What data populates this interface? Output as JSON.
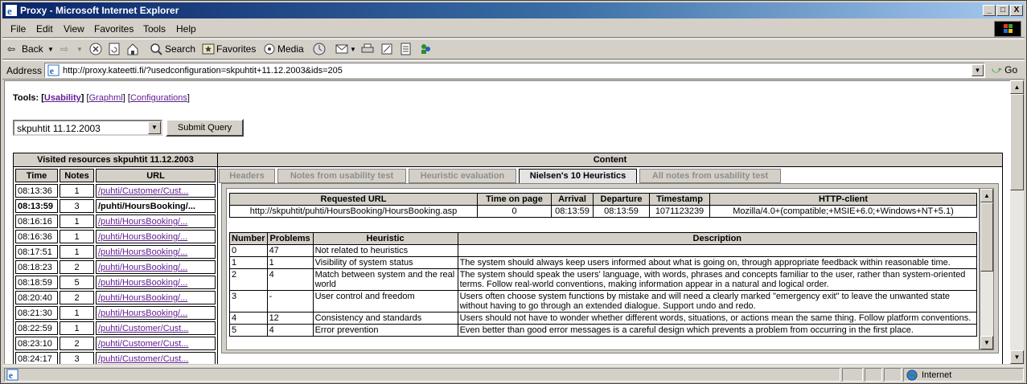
{
  "window": {
    "title": "Proxy - Microsoft Internet Explorer",
    "min": "_",
    "max": "□",
    "close": "X"
  },
  "menu": [
    "File",
    "Edit",
    "View",
    "Favorites",
    "Tools",
    "Help"
  ],
  "toolbar": {
    "back": "Back",
    "search": "Search",
    "favorites": "Favorites",
    "media": "Media"
  },
  "address": {
    "label": "Address",
    "url": "http://proxy.kateetti.fi/?usedconfiguration=skpuhtit+11.12.2003&ids=205",
    "go": "Go"
  },
  "tools": {
    "label": "Tools:",
    "links": [
      "Usability",
      "Graphml",
      "Configurations"
    ]
  },
  "config": {
    "selected": "skpuhtit 11.12.2003",
    "submit": "Submit Query"
  },
  "visited": {
    "title": "Visited resources skpuhtit 11.12.2003",
    "columns": [
      "Time",
      "Notes",
      "URL"
    ],
    "rows": [
      {
        "time": "08:13:36",
        "notes": "1",
        "url": "/puhti/Customer/Cust..."
      },
      {
        "time": "08:13:59",
        "notes": "3",
        "url": "/puhti/HoursBooking/..."
      },
      {
        "time": "08:16:16",
        "notes": "1",
        "url": "/puhti/HoursBooking/..."
      },
      {
        "time": "08:16:36",
        "notes": "1",
        "url": "/puhti/HoursBooking/..."
      },
      {
        "time": "08:17:51",
        "notes": "1",
        "url": "/puhti/HoursBooking/..."
      },
      {
        "time": "08:18:23",
        "notes": "2",
        "url": "/puhti/HoursBooking/..."
      },
      {
        "time": "08:18:59",
        "notes": "5",
        "url": "/puhti/HoursBooking/..."
      },
      {
        "time": "08:20:40",
        "notes": "2",
        "url": "/puhti/HoursBooking/..."
      },
      {
        "time": "08:21:30",
        "notes": "1",
        "url": "/puhti/HoursBooking/..."
      },
      {
        "time": "08:22:59",
        "notes": "1",
        "url": "/puhti/Customer/Cust..."
      },
      {
        "time": "08:23:10",
        "notes": "2",
        "url": "/puhti/Customer/Cust..."
      },
      {
        "time": "08:24:17",
        "notes": "3",
        "url": "/puhti/Customer/Cust..."
      }
    ]
  },
  "content": {
    "title": "Content",
    "tabs": [
      "Headers",
      "Notes from usability test",
      "Heuristic evaluation",
      "Nielsen's 10 Heuristics",
      "All notes from usability test"
    ],
    "request": {
      "columns": [
        "Requested URL",
        "Time on page",
        "Arrival",
        "Departure",
        "Timestamp",
        "HTTP-client"
      ],
      "row": [
        "http://skpuhtit/puhti/HoursBooking/HoursBooking.asp",
        "0",
        "08:13:59",
        "08:13:59",
        "1071123239",
        "Mozilla/4.0+(compatible;+MSIE+6.0;+Windows+NT+5.1)"
      ]
    },
    "heuristics": {
      "columns": [
        "Number",
        "Problems",
        "Heuristic",
        "Description"
      ],
      "rows": [
        {
          "n": "0",
          "p": "47",
          "h": "Not related to heuristics",
          "d": ""
        },
        {
          "n": "1",
          "p": "1",
          "h": "Visibility of system status",
          "d": "The system should always keep users informed about what is going on, through appropriate feedback within reasonable time."
        },
        {
          "n": "2",
          "p": "4",
          "h": "Match between system and the real world",
          "d": "The system should speak the users' language, with words, phrases and concepts familiar to the user, rather than system-oriented terms. Follow real-world conventions, making information appear in a natural and logical order."
        },
        {
          "n": "3",
          "p": "-",
          "h": "User control and freedom",
          "d": "Users often choose system functions by mistake and will need a clearly marked \"emergency exit\" to leave the unwanted state without having to go through an extended dialogue. Support undo and redo."
        },
        {
          "n": "4",
          "p": "12",
          "h": "Consistency and standards",
          "d": "Users should not have to wonder whether different words, situations, or actions mean the same thing. Follow platform conventions."
        },
        {
          "n": "5",
          "p": "4",
          "h": "Error prevention",
          "d": "Even better than good error messages is a careful design which prevents a problem from occurring in the first place."
        }
      ]
    }
  },
  "status": {
    "zone": "Internet"
  }
}
